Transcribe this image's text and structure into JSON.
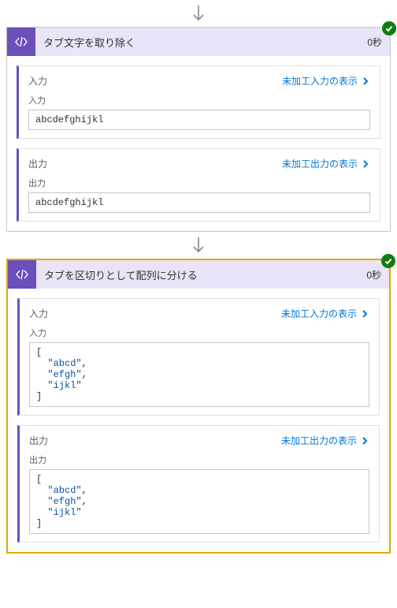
{
  "labels": {
    "input": "入力",
    "output": "出力",
    "show_raw_input": "未加工入力の表示",
    "show_raw_output": "未加工出力の表示"
  },
  "steps": [
    {
      "title": "タブ文字を取り除く",
      "duration": "0秒",
      "selected": false,
      "input_box": {
        "kind": "text",
        "text": "abcdefghijkl"
      },
      "output_box": {
        "kind": "text",
        "text": "abcdefghijkl"
      }
    },
    {
      "title": "タブを区切りとして配列に分ける",
      "duration": "0秒",
      "selected": true,
      "input_box": {
        "kind": "json",
        "items": [
          "abcd",
          "efgh",
          "ijkl"
        ]
      },
      "output_box": {
        "kind": "json",
        "items": [
          "abcd",
          "efgh",
          "ijkl"
        ]
      }
    }
  ]
}
